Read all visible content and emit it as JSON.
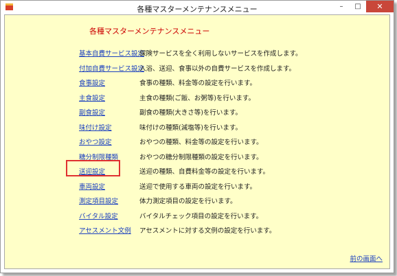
{
  "window": {
    "title": "各種マスターメンテナンスメニュー",
    "minimize": "–",
    "maximize": "□",
    "close": "✕"
  },
  "heading": "各種マスターメンテナンスメニュー",
  "items": [
    {
      "link": "基本自費サービス設定",
      "desc": "保険サービスを全く利用しないサービスを作成します。"
    },
    {
      "link": "付加自費サービス設定",
      "desc": "入浴、送迎、食事以外の自費サービスを作成します。"
    },
    {
      "link": "食事設定",
      "desc": "食事の種類、料金等の設定を行います。"
    },
    {
      "link": "主食設定",
      "desc": "主食の種類(ご飯、お粥等)を行います。"
    },
    {
      "link": "副食設定",
      "desc": "副食の種類(大きさ等)を行います。"
    },
    {
      "link": "味付け設定",
      "desc": "味付けの種類(減塩等)を行います。"
    },
    {
      "link": "おやつ設定",
      "desc": "おやつの種類、料金等の設定を行います。"
    },
    {
      "link": "糖分制限種類",
      "desc": "おやつの糖分制限種類の設定を行います。"
    },
    {
      "link": "送迎設定",
      "desc": "送迎の種類、自費料金等の設定を行います。"
    },
    {
      "link": "車両設定",
      "desc": "送迎で使用する車両の設定を行います。"
    },
    {
      "link": "測定項目設定",
      "desc": "体力測定項目の設定を行います。"
    },
    {
      "link": "バイタル設定",
      "desc": "バイタルチェック項目の設定を行います。"
    },
    {
      "link": "アセスメント文例",
      "desc": "アセスメントに対する文例の設定を行います。"
    }
  ],
  "back_link": "前の画面へ"
}
